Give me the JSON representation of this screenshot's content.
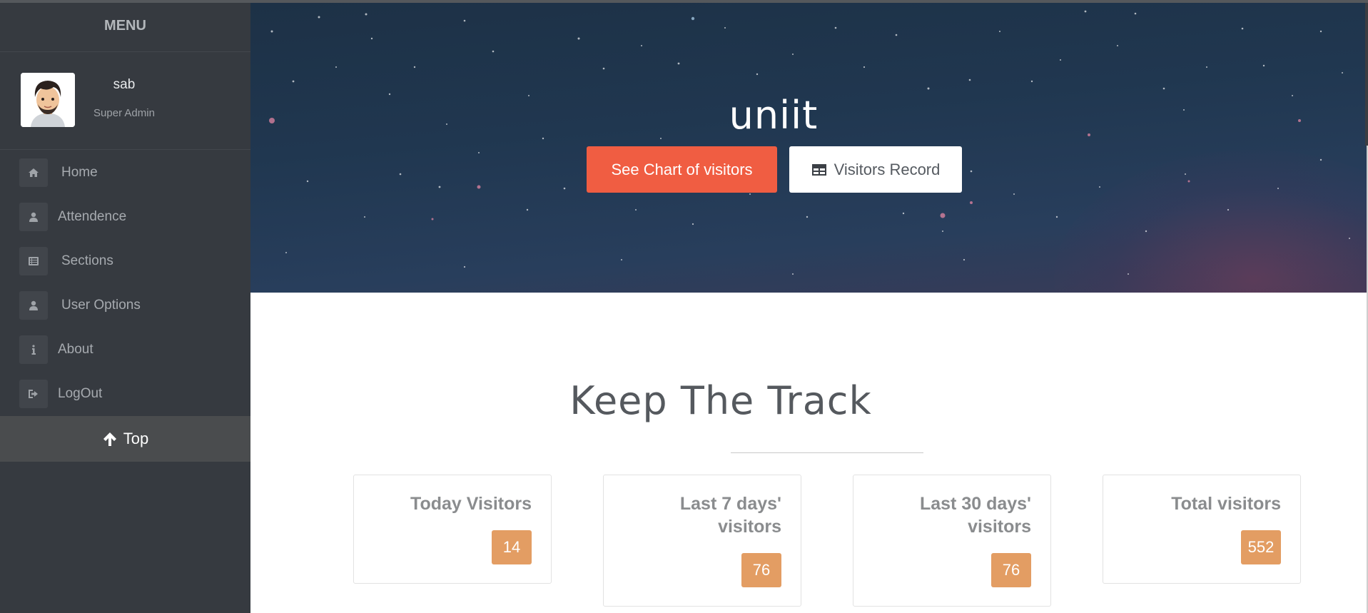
{
  "sidebar": {
    "menu_title": "MENU",
    "user": {
      "name": "sab",
      "role": "Super Admin"
    },
    "items": [
      {
        "label": "Home",
        "icon": "home-icon"
      },
      {
        "label": "Attendence",
        "icon": "user-icon"
      },
      {
        "label": "Sections",
        "icon": "list-icon"
      },
      {
        "label": "User Options",
        "icon": "user-icon"
      },
      {
        "label": "About",
        "icon": "info-icon"
      },
      {
        "label": "LogOut",
        "icon": "logout-icon"
      }
    ],
    "top_button": {
      "label": "Top",
      "icon": "arrow-up-icon"
    }
  },
  "hero": {
    "title": "uniit",
    "chart_button": "See Chart of visitors",
    "record_button": "Visitors Record",
    "record_icon": "table-icon"
  },
  "main": {
    "section_title": "Keep The Track",
    "stats": [
      {
        "title_line1": "Today Visitors",
        "title_line2": "",
        "value": "14"
      },
      {
        "title_line1": "Last 7 days'",
        "title_line2": "visitors",
        "value": "76"
      },
      {
        "title_line1": "Last 30 days'",
        "title_line2": "visitors",
        "value": "76"
      },
      {
        "title_line1": "Total visitors",
        "title_line2": "",
        "value": "552"
      }
    ]
  },
  "colors": {
    "sidebar_bg": "#363a40",
    "accent_button": "#f05d42",
    "badge": "#e39d63",
    "hero_bg": "#203750"
  }
}
